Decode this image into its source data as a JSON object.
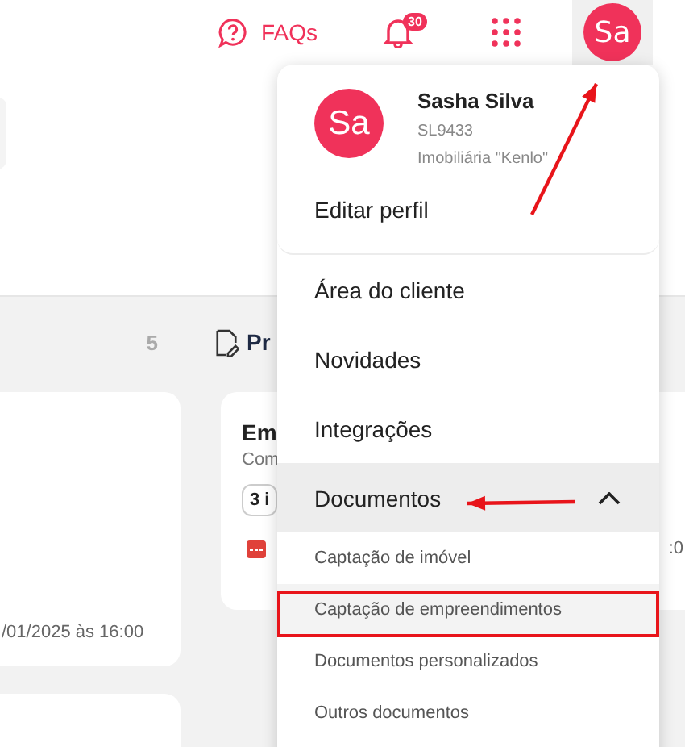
{
  "topbar": {
    "faq_label": "FAQs",
    "notification_count": "30",
    "avatar_initials": "Sa"
  },
  "background": {
    "section_count": "5",
    "section_title": "Pr",
    "left_card": {
      "date": "/01/2025 às 16:00"
    },
    "right_card": {
      "title": "Em",
      "subtitle": "Com",
      "chip": "3 i",
      "time": ":0"
    }
  },
  "user_menu": {
    "profile": {
      "initials": "Sa",
      "name": "Sasha Silva",
      "code": "SL9433",
      "company": "Imobiliária \"Kenlo\""
    },
    "edit_profile": "Editar perfil",
    "items": [
      {
        "label": "Área do cliente",
        "expanded": false
      },
      {
        "label": "Novidades",
        "expanded": false
      },
      {
        "label": "Integrações",
        "expanded": false
      },
      {
        "label": "Documentos",
        "expanded": true,
        "children": [
          {
            "label": "Captação de imóvel",
            "selected": false
          },
          {
            "label": "Captação de empreendimentos",
            "selected": true
          },
          {
            "label": "Documentos personalizados",
            "selected": false
          },
          {
            "label": "Outros documentos",
            "selected": false
          }
        ]
      }
    ]
  },
  "annotations": [
    {
      "kind": "arrow"
    },
    {
      "kind": "arrow"
    },
    {
      "kind": "box"
    }
  ]
}
